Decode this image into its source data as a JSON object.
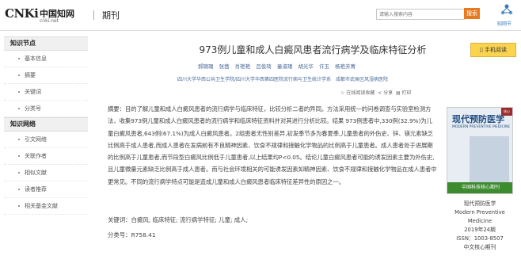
{
  "header": {
    "logo_text": "CNKi",
    "logo_cn": "中国知网",
    "logo_sub": "cnki.net",
    "nav_label": "期刊",
    "search_placeholder": "请输入搜索内容",
    "search_button": "搜索",
    "right_logo_label": "知网节"
  },
  "sidebar": {
    "section1_title": "知识节点",
    "section1_items": [
      "基本信息",
      "摘要",
      "关键词",
      "分类号"
    ],
    "section2_title": "知识网络",
    "section2_items": [
      "引文网络",
      "关联作者",
      "相似文献",
      "读者推荐",
      "相关基金文献"
    ]
  },
  "article": {
    "title": "973例儿童和成人白癜风患者流行病学及临床特征分析",
    "authors": [
      "郝璐璐",
      "张茜",
      "肖艳艳",
      "吕俊琦",
      "童淑瑾",
      "胡光华",
      "许玉",
      "杨艳芳菁"
    ],
    "affiliations": "四川大学华西公共卫生学院/四川大学华西第四医院流行病与卫生统计学系　成都市武侯区风湿病医院",
    "share": {
      "collect": "在线阅读收藏",
      "share": "分享",
      "print": "打印"
    },
    "abstract_label": "摘要：",
    "abstract_text": "目的了解儿童和成人白癜风患者的流行病学与临床特征，比较分析二者的异同。方法采用统一的问卷调查与实验室检测方法，收集973例儿童和成人白癜风患者的流行病学和临床特征资料并对其进行分析比较。结果 973例患者中,330例(32.9%)为儿童白癜风患者,643例(67.1%)为成人白癜风患者。2组患者无性别差异,初发季节多为春夏季,儿童患者的外伤史、锌、镁元素缺乏比例高于成人患者,而成人患者在发病前有不良精神因素、饮食不规律和接触化学物品的比例高于儿童患者。成人患者处于进展期的比例高于儿童患者,而节段型白癜风比例低于儿童患者,以上结果均P<0.05。结论儿童白癜风患者可能的诱发因素主要为外伤史,且儿童微量元素缺乏比例高于成人患者。而与社会环境相关的可能诱发因素如精神因素、饮食不规律和接触化学物品在成人患者中更常见。不同的流行病学特点可能是造成儿童和成人白癜风患者临床特征差异性的原因之一。",
    "keywords_label": "关键词：",
    "keywords": "白癜风; 临床特征; 流行病学特征; 儿童; 成人;",
    "class_label": "分类号：",
    "class_no": "R758.41"
  },
  "journal": {
    "download_label": "手机阅读",
    "cover_title": "现代预防医学",
    "cover_subtitle": "MODERN PREVENTIVE MEDICINE",
    "cover_band": "中国科技核心期刊",
    "cover_tag": "核心",
    "name_cn": "现代预防医学",
    "name_en": "Modern Preventive Medicine",
    "issue": "2019年24期",
    "issn": "ISSN：1003-8507",
    "core": "中文核心期刊"
  }
}
